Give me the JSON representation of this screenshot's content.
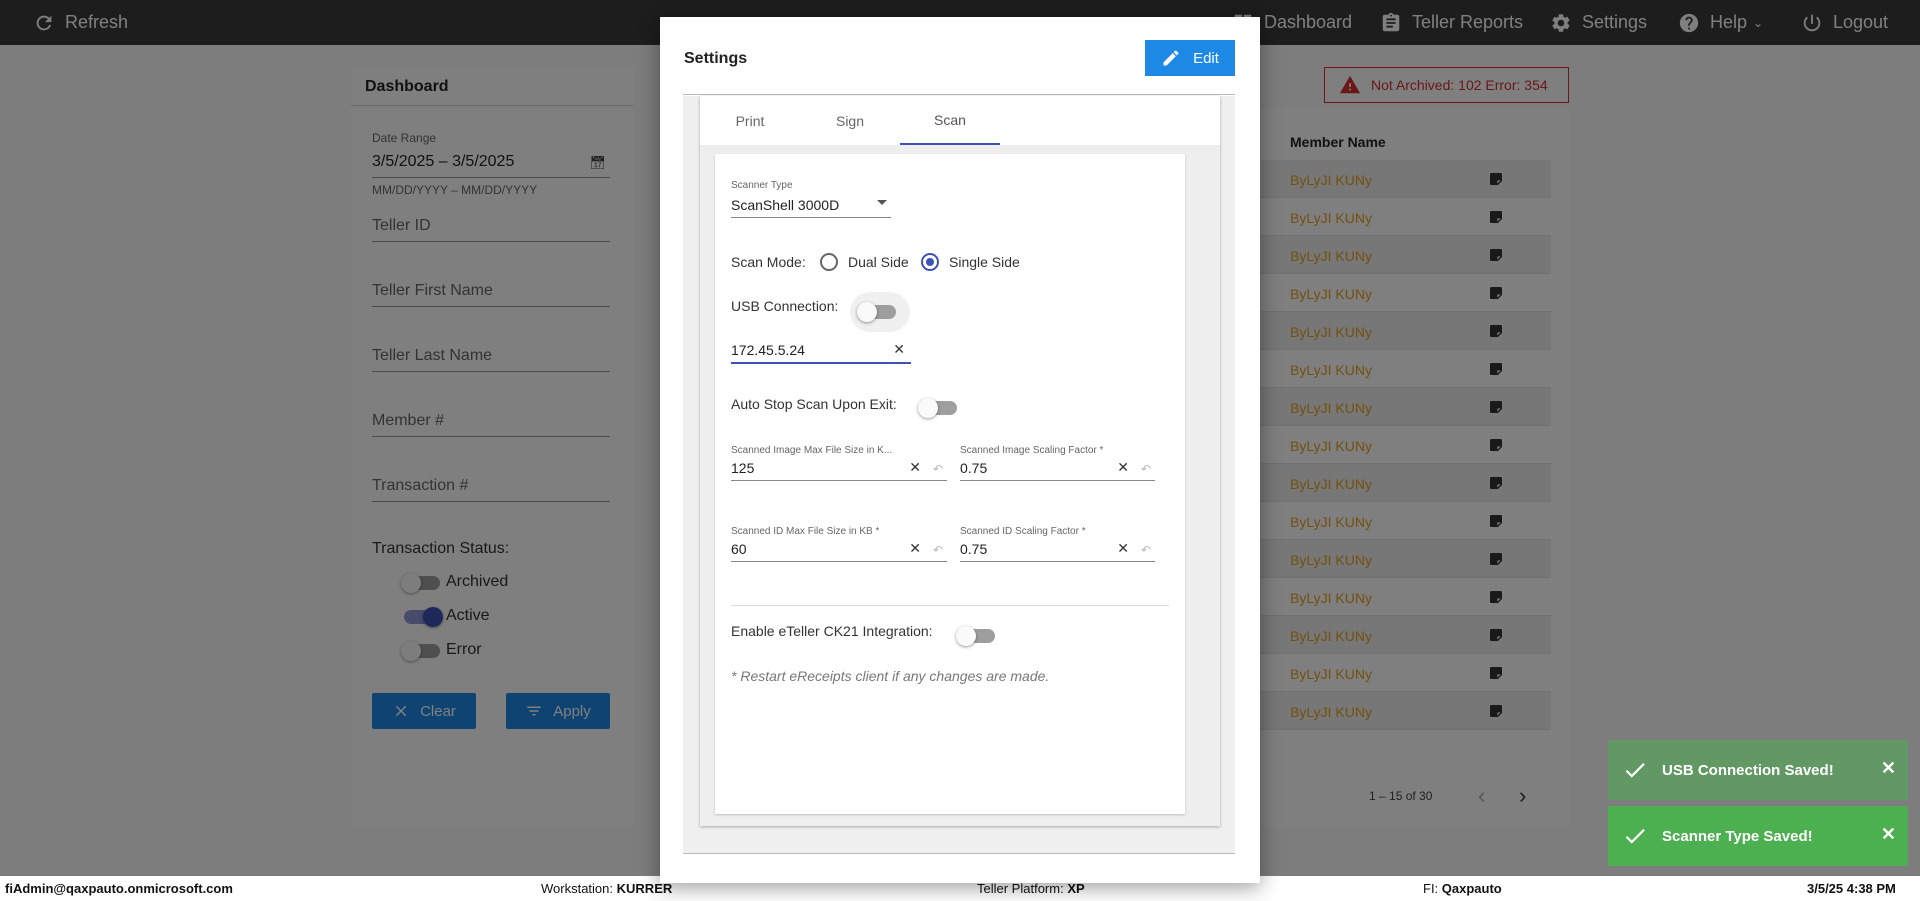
{
  "topbar": {
    "refresh": "Refresh",
    "dashboard": "Dashboard",
    "teller_reports": "Teller Reports",
    "settings": "Settings",
    "help": "Help",
    "logout": "Logout"
  },
  "dashboard": {
    "title": "Dashboard",
    "date_range_label": "Date Range",
    "date_range_value": "3/5/2025 – 3/5/2025",
    "date_hint": "MM/DD/YYYY – MM/DD/YYYY",
    "teller_id": "Teller ID",
    "teller_first": "Teller First Name",
    "teller_last": "Teller Last Name",
    "member_no": "Member #",
    "transaction_no": "Transaction #",
    "status_label": "Transaction Status:",
    "archived": "Archived",
    "active": "Active",
    "error": "Error",
    "clear": "Clear",
    "apply": "Apply"
  },
  "error_badge": "Not Archived: 102  Error: 354",
  "table": {
    "member_name_header": "Member Name",
    "rows": [
      "ByLyJI KUNy",
      "ByLyJI KUNy",
      "ByLyJI KUNy",
      "ByLyJI KUNy",
      "ByLyJI KUNy",
      "ByLyJI KUNy",
      "ByLyJI KUNy",
      "ByLyJI KUNy",
      "ByLyJI KUNy",
      "ByLyJI KUNy",
      "ByLyJI KUNy",
      "ByLyJI KUNy",
      "ByLyJI KUNy",
      "ByLyJI KUNy",
      "ByLyJI KUNy"
    ],
    "pager": "1 – 15 of 30"
  },
  "statusbar": {
    "user": "fiAdmin@qaxpauto.onmicrosoft.com",
    "workstation_label": "Workstation:",
    "workstation": "KURRER",
    "platform_label": "Teller Platform:",
    "platform": "XP",
    "fi_label": "FI:",
    "fi": "Qaxpauto",
    "datetime": "3/5/25 4:38 PM"
  },
  "modal": {
    "title": "Settings",
    "edit": "Edit",
    "tabs": [
      "Print",
      "Sign",
      "Scan"
    ],
    "scanner_type_label": "Scanner Type",
    "scanner_type_value": "ScanShell 3000D",
    "scan_mode_label": "Scan Mode:",
    "dual_side": "Dual Side",
    "single_side": "Single Side",
    "usb_label": "USB Connection:",
    "ip_value": "172.45.5.24",
    "auto_stop_label": "Auto Stop Scan Upon Exit:",
    "img_max_label": "Scanned Image Max File Size in K...",
    "img_max_value": "125",
    "img_scale_label": "Scanned Image Scaling Factor *",
    "img_scale_value": "0.75",
    "id_max_label": "Scanned ID Max File Size in KB *",
    "id_max_value": "60",
    "id_scale_label": "Scanned ID Scaling Factor *",
    "id_scale_value": "0.75",
    "ck21_label": "Enable eTeller CK21 Integration:",
    "note": "* Restart eReceipts client if any changes are made."
  },
  "toasts": {
    "usb_saved": "USB Connection Saved!",
    "scanner_saved": "Scanner Type Saved!"
  },
  "colors": {
    "primary": "#1e88e5",
    "accent": "#3f51b5",
    "success": "#4caf50",
    "error": "#d32f2f",
    "member_name": "#e6a020"
  }
}
